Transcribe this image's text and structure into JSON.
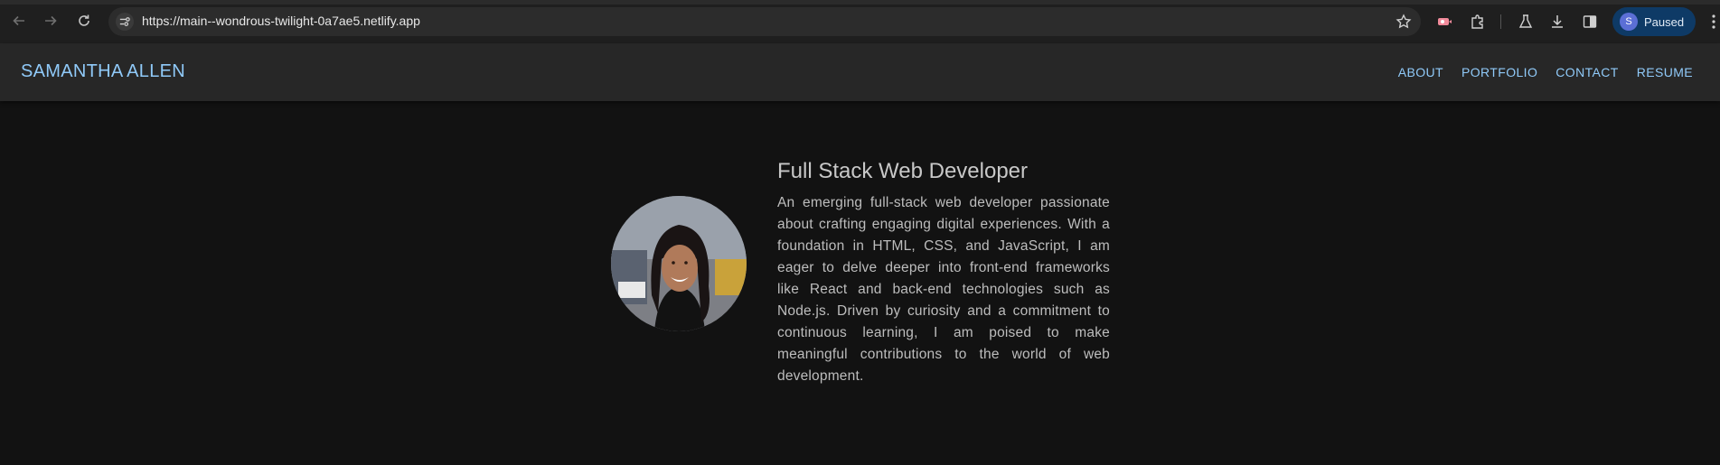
{
  "browser": {
    "url": "https://main--wondrous-twilight-0a7ae5.netlify.app",
    "profile_initial": "S",
    "profile_label": "Paused",
    "icons": [
      "back-icon",
      "forward-icon",
      "reload-icon",
      "site-settings-icon",
      "star-icon",
      "extension-record-icon",
      "extensions-icon",
      "labs-icon",
      "download-icon",
      "side-panel-icon",
      "menu-icon"
    ]
  },
  "site": {
    "brand": "SAMANTHA ALLEN",
    "nav": [
      "ABOUT",
      "PORTFOLIO",
      "CONTACT",
      "RESUME"
    ]
  },
  "hero": {
    "title": "Full Stack Web Developer",
    "text": "An emerging full-stack web developer passionate about crafting engaging digital experiences. With a foundation in HTML, CSS, and JavaScript, I am eager to delve deeper into front-end frameworks like React and back-end technologies such as Node.js. Driven by curiosity and a commitment to continuous learning, I am poised to make meaningful contributions to the world of web development."
  },
  "colors": {
    "accent": "#90caf9",
    "page_bg": "#121212",
    "header_bg": "#272727"
  }
}
